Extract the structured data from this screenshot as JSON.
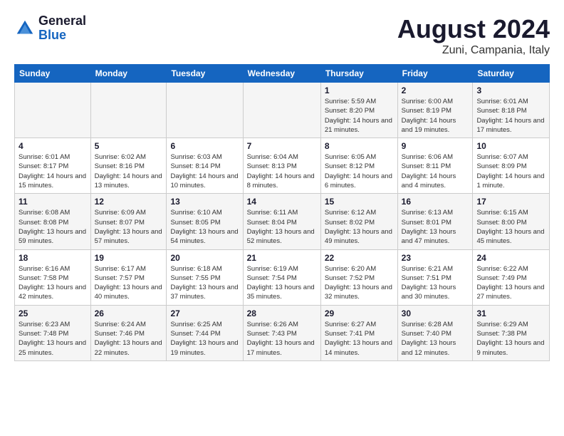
{
  "header": {
    "logo": {
      "general": "General",
      "blue": "Blue"
    },
    "title": "August 2024",
    "location": "Zuni, Campania, Italy"
  },
  "calendar": {
    "days_of_week": [
      "Sunday",
      "Monday",
      "Tuesday",
      "Wednesday",
      "Thursday",
      "Friday",
      "Saturday"
    ],
    "weeks": [
      [
        {
          "day": "",
          "content": ""
        },
        {
          "day": "",
          "content": ""
        },
        {
          "day": "",
          "content": ""
        },
        {
          "day": "",
          "content": ""
        },
        {
          "day": "1",
          "content": "Sunrise: 5:59 AM\nSunset: 8:20 PM\nDaylight: 14 hours\nand 21 minutes."
        },
        {
          "day": "2",
          "content": "Sunrise: 6:00 AM\nSunset: 8:19 PM\nDaylight: 14 hours\nand 19 minutes."
        },
        {
          "day": "3",
          "content": "Sunrise: 6:01 AM\nSunset: 8:18 PM\nDaylight: 14 hours\nand 17 minutes."
        }
      ],
      [
        {
          "day": "4",
          "content": "Sunrise: 6:01 AM\nSunset: 8:17 PM\nDaylight: 14 hours\nand 15 minutes."
        },
        {
          "day": "5",
          "content": "Sunrise: 6:02 AM\nSunset: 8:16 PM\nDaylight: 14 hours\nand 13 minutes."
        },
        {
          "day": "6",
          "content": "Sunrise: 6:03 AM\nSunset: 8:14 PM\nDaylight: 14 hours\nand 10 minutes."
        },
        {
          "day": "7",
          "content": "Sunrise: 6:04 AM\nSunset: 8:13 PM\nDaylight: 14 hours\nand 8 minutes."
        },
        {
          "day": "8",
          "content": "Sunrise: 6:05 AM\nSunset: 8:12 PM\nDaylight: 14 hours\nand 6 minutes."
        },
        {
          "day": "9",
          "content": "Sunrise: 6:06 AM\nSunset: 8:11 PM\nDaylight: 14 hours\nand 4 minutes."
        },
        {
          "day": "10",
          "content": "Sunrise: 6:07 AM\nSunset: 8:09 PM\nDaylight: 14 hours\nand 1 minute."
        }
      ],
      [
        {
          "day": "11",
          "content": "Sunrise: 6:08 AM\nSunset: 8:08 PM\nDaylight: 13 hours\nand 59 minutes."
        },
        {
          "day": "12",
          "content": "Sunrise: 6:09 AM\nSunset: 8:07 PM\nDaylight: 13 hours\nand 57 minutes."
        },
        {
          "day": "13",
          "content": "Sunrise: 6:10 AM\nSunset: 8:05 PM\nDaylight: 13 hours\nand 54 minutes."
        },
        {
          "day": "14",
          "content": "Sunrise: 6:11 AM\nSunset: 8:04 PM\nDaylight: 13 hours\nand 52 minutes."
        },
        {
          "day": "15",
          "content": "Sunrise: 6:12 AM\nSunset: 8:02 PM\nDaylight: 13 hours\nand 49 minutes."
        },
        {
          "day": "16",
          "content": "Sunrise: 6:13 AM\nSunset: 8:01 PM\nDaylight: 13 hours\nand 47 minutes."
        },
        {
          "day": "17",
          "content": "Sunrise: 6:15 AM\nSunset: 8:00 PM\nDaylight: 13 hours\nand 45 minutes."
        }
      ],
      [
        {
          "day": "18",
          "content": "Sunrise: 6:16 AM\nSunset: 7:58 PM\nDaylight: 13 hours\nand 42 minutes."
        },
        {
          "day": "19",
          "content": "Sunrise: 6:17 AM\nSunset: 7:57 PM\nDaylight: 13 hours\nand 40 minutes."
        },
        {
          "day": "20",
          "content": "Sunrise: 6:18 AM\nSunset: 7:55 PM\nDaylight: 13 hours\nand 37 minutes."
        },
        {
          "day": "21",
          "content": "Sunrise: 6:19 AM\nSunset: 7:54 PM\nDaylight: 13 hours\nand 35 minutes."
        },
        {
          "day": "22",
          "content": "Sunrise: 6:20 AM\nSunset: 7:52 PM\nDaylight: 13 hours\nand 32 minutes."
        },
        {
          "day": "23",
          "content": "Sunrise: 6:21 AM\nSunset: 7:51 PM\nDaylight: 13 hours\nand 30 minutes."
        },
        {
          "day": "24",
          "content": "Sunrise: 6:22 AM\nSunset: 7:49 PM\nDaylight: 13 hours\nand 27 minutes."
        }
      ],
      [
        {
          "day": "25",
          "content": "Sunrise: 6:23 AM\nSunset: 7:48 PM\nDaylight: 13 hours\nand 25 minutes."
        },
        {
          "day": "26",
          "content": "Sunrise: 6:24 AM\nSunset: 7:46 PM\nDaylight: 13 hours\nand 22 minutes."
        },
        {
          "day": "27",
          "content": "Sunrise: 6:25 AM\nSunset: 7:44 PM\nDaylight: 13 hours\nand 19 minutes."
        },
        {
          "day": "28",
          "content": "Sunrise: 6:26 AM\nSunset: 7:43 PM\nDaylight: 13 hours\nand 17 minutes."
        },
        {
          "day": "29",
          "content": "Sunrise: 6:27 AM\nSunset: 7:41 PM\nDaylight: 13 hours\nand 14 minutes."
        },
        {
          "day": "30",
          "content": "Sunrise: 6:28 AM\nSunset: 7:40 PM\nDaylight: 13 hours\nand 12 minutes."
        },
        {
          "day": "31",
          "content": "Sunrise: 6:29 AM\nSunset: 7:38 PM\nDaylight: 13 hours\nand 9 minutes."
        }
      ]
    ]
  }
}
